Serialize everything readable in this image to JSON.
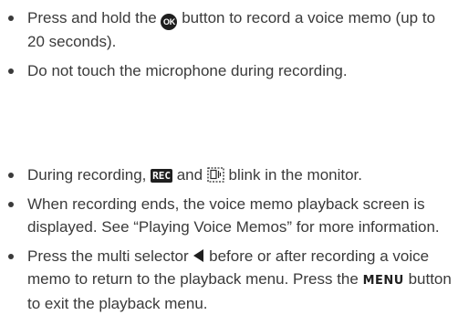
{
  "list_one": {
    "item1": {
      "before": "Press and hold the ",
      "icon_label": "OK",
      "after": " button to record a voice memo (up to 20 seconds)."
    },
    "item2": {
      "text": "Do not touch the microphone during recording."
    }
  },
  "list_two": {
    "item1": {
      "before": "During recording, ",
      "rec_label": "REC",
      "middle": " and ",
      "after": " blink in the monitor."
    },
    "item2": {
      "text": "When recording ends, the voice memo playback screen is displayed. See “Playing Voice Memos” for more information."
    },
    "item3": {
      "before": "Press the multi selector ",
      "middle": " before or after recording a voice memo to return to the playback menu. Press the ",
      "menu_label": "MENU",
      "after": " button to exit the playback menu."
    }
  },
  "icons": {
    "ok": "ok-button-icon",
    "rec": "rec-indicator-icon",
    "voice": "voice-memo-icon",
    "left": "multi-selector-left-icon"
  }
}
